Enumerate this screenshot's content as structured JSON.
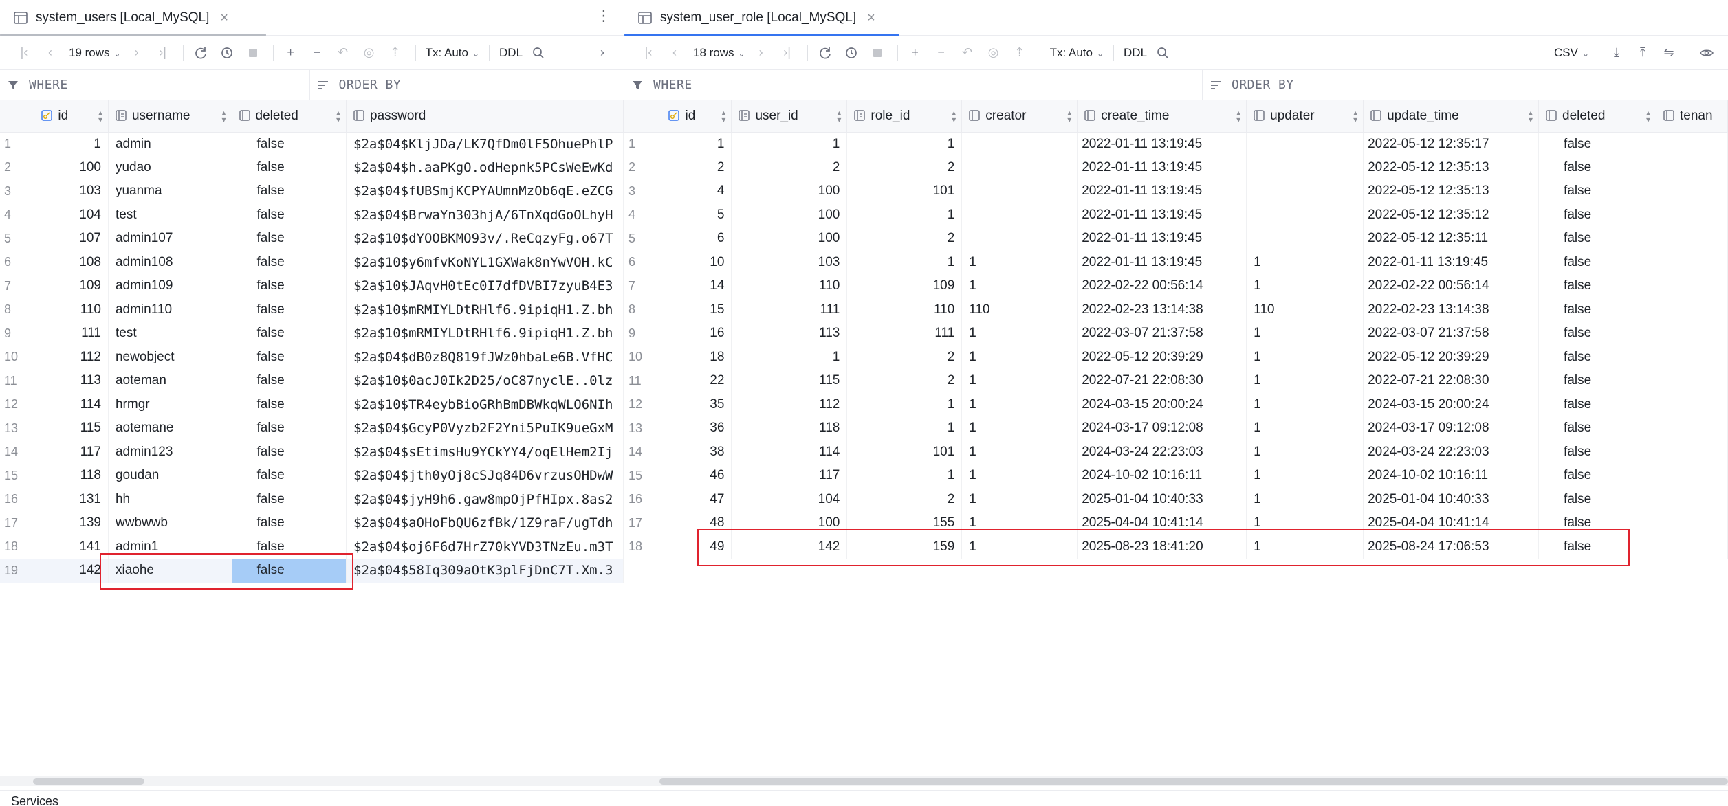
{
  "left": {
    "tab_title": "system_users [Local_MySQL]",
    "rows_label": "19 rows",
    "tx_label": "Tx: Auto",
    "ddl_label": "DDL",
    "where_label": "WHERE",
    "order_label": "ORDER BY",
    "columns": [
      "id",
      "username",
      "deleted",
      "password"
    ],
    "rows": [
      [
        "1",
        "1",
        "admin",
        "false",
        "$2a$04$KljJDa/LK7QfDm0lF5OhuePhlP"
      ],
      [
        "2",
        "100",
        "yudao",
        "false",
        "$2a$04$h.aaPKgO.odHepnk5PCsWeEwKd"
      ],
      [
        "3",
        "103",
        "yuanma",
        "false",
        "$2a$04$fUBSmjKCPYAUmnMzOb6qE.eZCG"
      ],
      [
        "4",
        "104",
        "test",
        "false",
        "$2a$04$BrwaYn303hjA/6TnXqdGoOLhyH"
      ],
      [
        "5",
        "107",
        "admin107",
        "false",
        "$2a$10$dYOOBKMO93v/.ReCqzyFg.o67T"
      ],
      [
        "6",
        "108",
        "admin108",
        "false",
        "$2a$10$y6mfvKoNYL1GXWak8nYwVOH.kC"
      ],
      [
        "7",
        "109",
        "admin109",
        "false",
        "$2a$10$JAqvH0tEc0I7dfDVBI7zyuB4E3"
      ],
      [
        "8",
        "110",
        "admin110",
        "false",
        "$2a$10$mRMIYLDtRHlf6.9ipiqH1.Z.bh"
      ],
      [
        "9",
        "111",
        "test",
        "false",
        "$2a$10$mRMIYLDtRHlf6.9ipiqH1.Z.bh"
      ],
      [
        "10",
        "112",
        "newobject",
        "false",
        "$2a$04$dB0z8Q819fJWz0hbaLe6B.VfHC"
      ],
      [
        "11",
        "113",
        "aoteman",
        "false",
        "$2a$10$0acJ0Ik2D25/oC87nyclE..0lz"
      ],
      [
        "12",
        "114",
        "hrmgr",
        "false",
        "$2a$10$TR4eybBioGRhBmDBWkqWLO6NIh"
      ],
      [
        "13",
        "115",
        "aotemane",
        "false",
        "$2a$04$GcyP0Vyzb2F2Yni5PuIK9ueGxM"
      ],
      [
        "14",
        "117",
        "admin123",
        "false",
        "$2a$04$sEtimsHu9YCkYY4/oqElHem2Ij"
      ],
      [
        "15",
        "118",
        "goudan",
        "false",
        "$2a$04$jth0yOj8cSJq84D6vrzusOHDwW"
      ],
      [
        "16",
        "131",
        "hh",
        "false",
        "$2a$04$jyH9h6.gaw8mpOjPfHIpx.8as2"
      ],
      [
        "17",
        "139",
        "wwbwwb",
        "false",
        "$2a$04$aOHoFbQU6zfBk/1Z9raF/ugTdh"
      ],
      [
        "18",
        "141",
        "admin1",
        "false",
        "$2a$04$oj6F6d7HrZ70kYVD3TNzEu.m3T"
      ],
      [
        "19",
        "142",
        "xiaohe",
        "false",
        "$2a$04$58Iq309aOtK3plFjDnC7T.Xm.3"
      ]
    ]
  },
  "right": {
    "tab_title": "system_user_role [Local_MySQL]",
    "rows_label": "18 rows",
    "tx_label": "Tx: Auto",
    "ddl_label": "DDL",
    "csv_label": "CSV",
    "where_label": "WHERE",
    "order_label": "ORDER BY",
    "columns": [
      "id",
      "user_id",
      "role_id",
      "creator",
      "create_time",
      "updater",
      "update_time",
      "deleted",
      "tenan"
    ],
    "rows": [
      [
        "1",
        "1",
        "1",
        "1",
        "",
        "2022-01-11 13:19:45",
        "",
        "2022-05-12 12:35:17",
        "false"
      ],
      [
        "2",
        "2",
        "2",
        "2",
        "",
        "2022-01-11 13:19:45",
        "",
        "2022-05-12 12:35:13",
        "false"
      ],
      [
        "3",
        "4",
        "100",
        "101",
        "",
        "2022-01-11 13:19:45",
        "",
        "2022-05-12 12:35:13",
        "false"
      ],
      [
        "4",
        "5",
        "100",
        "1",
        "",
        "2022-01-11 13:19:45",
        "",
        "2022-05-12 12:35:12",
        "false"
      ],
      [
        "5",
        "6",
        "100",
        "2",
        "",
        "2022-01-11 13:19:45",
        "",
        "2022-05-12 12:35:11",
        "false"
      ],
      [
        "6",
        "10",
        "103",
        "1",
        "1",
        "2022-01-11 13:19:45",
        "1",
        "2022-01-11 13:19:45",
        "false"
      ],
      [
        "7",
        "14",
        "110",
        "109",
        "1",
        "2022-02-22 00:56:14",
        "1",
        "2022-02-22 00:56:14",
        "false"
      ],
      [
        "8",
        "15",
        "111",
        "110",
        "110",
        "2022-02-23 13:14:38",
        "110",
        "2022-02-23 13:14:38",
        "false"
      ],
      [
        "9",
        "16",
        "113",
        "111",
        "1",
        "2022-03-07 21:37:58",
        "1",
        "2022-03-07 21:37:58",
        "false"
      ],
      [
        "10",
        "18",
        "1",
        "2",
        "1",
        "2022-05-12 20:39:29",
        "1",
        "2022-05-12 20:39:29",
        "false"
      ],
      [
        "11",
        "22",
        "115",
        "2",
        "1",
        "2022-07-21 22:08:30",
        "1",
        "2022-07-21 22:08:30",
        "false"
      ],
      [
        "12",
        "35",
        "112",
        "1",
        "1",
        "2024-03-15 20:00:24",
        "1",
        "2024-03-15 20:00:24",
        "false"
      ],
      [
        "13",
        "36",
        "118",
        "1",
        "1",
        "2024-03-17 09:12:08",
        "1",
        "2024-03-17 09:12:08",
        "false"
      ],
      [
        "14",
        "38",
        "114",
        "101",
        "1",
        "2024-03-24 22:23:03",
        "1",
        "2024-03-24 22:23:03",
        "false"
      ],
      [
        "15",
        "46",
        "117",
        "1",
        "1",
        "2024-10-02 10:16:11",
        "1",
        "2024-10-02 10:16:11",
        "false"
      ],
      [
        "16",
        "47",
        "104",
        "2",
        "1",
        "2025-01-04 10:40:33",
        "1",
        "2025-01-04 10:40:33",
        "false"
      ],
      [
        "17",
        "48",
        "100",
        "155",
        "1",
        "2025-04-04 10:41:14",
        "1",
        "2025-04-04 10:41:14",
        "false"
      ],
      [
        "18",
        "49",
        "142",
        "159",
        "1",
        "2025-08-23 18:41:20",
        "1",
        "2025-08-24 17:06:53",
        "false"
      ]
    ]
  },
  "status_bar": {
    "text": "Services"
  },
  "colors": {
    "accent": "#3574f0",
    "highlight_box": "#e0232e",
    "selected_cell": "#a6ccf7"
  }
}
